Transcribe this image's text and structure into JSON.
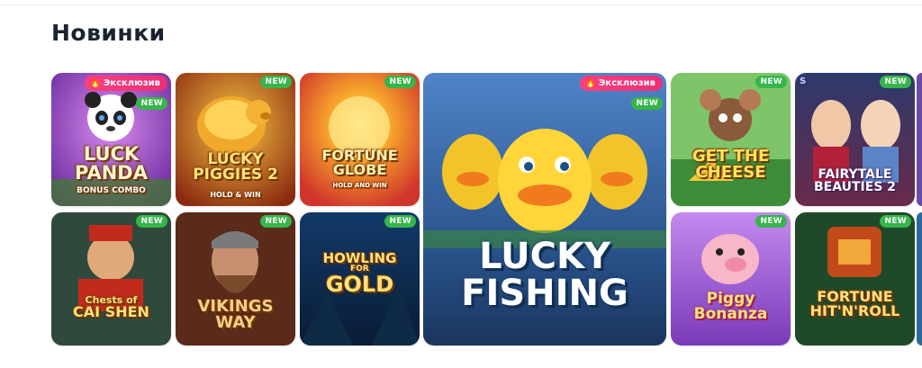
{
  "section": {
    "title": "Новинки"
  },
  "badges": {
    "new": "NEW",
    "exclusive": "Эксклюзив"
  },
  "games": [
    {
      "id": "luck-of-panda",
      "title_lines": [
        "LUCK",
        "PANDA"
      ],
      "subtitle": "BONUS COMBO",
      "badges": [
        "exclusive",
        "new"
      ]
    },
    {
      "id": "lucky-piggies-2",
      "title_lines": [
        "LUCKY",
        "PIGGIES 2"
      ],
      "subtitle": "HOLD & WIN",
      "badges": [
        "new"
      ]
    },
    {
      "id": "fortune-globe",
      "title_lines": [
        "FORTUNE",
        "GLOBE"
      ],
      "subtitle": "HOLD AND WIN",
      "badges": [
        "new"
      ]
    },
    {
      "id": "lucky-fishing",
      "title_lines": [
        "LUCKY",
        "FISHING"
      ],
      "subtitle": "",
      "badges": [
        "exclusive",
        "new"
      ]
    },
    {
      "id": "get-the-cheese",
      "title_lines": [
        "GET THE",
        "CHEESE"
      ],
      "subtitle": "",
      "badges": [
        "new"
      ]
    },
    {
      "id": "fairytale-beauties-2",
      "title_lines": [
        "FAIRYTALE",
        "BEAUTIES 2"
      ],
      "subtitle": "",
      "badges": [
        "new"
      ],
      "corner_mark": "S"
    },
    {
      "id": "chests-of-cai-shen",
      "title_lines": [
        "Chests of",
        "CAI SHEN"
      ],
      "subtitle": "",
      "badges": [
        "new"
      ]
    },
    {
      "id": "vikings-way",
      "title_lines": [
        "VIKINGS",
        "WAY"
      ],
      "subtitle": "",
      "badges": [
        "new"
      ]
    },
    {
      "id": "howling-for-gold",
      "title_lines": [
        "HOWLING",
        "GOLD"
      ],
      "subtitle": "FOR",
      "badges": [
        "new"
      ]
    },
    {
      "id": "piggy-bonanza",
      "title_lines": [
        "Piggy",
        "Bonanza"
      ],
      "subtitle": "",
      "badges": [
        "new"
      ]
    },
    {
      "id": "fortune-hit-n-roll",
      "title_lines": [
        "FORTUNE",
        "HIT'N'ROLL"
      ],
      "subtitle": "",
      "badges": [
        "new"
      ]
    }
  ],
  "colors": {
    "new_badge": "#35b54a",
    "exclusive_badge": "#ff3f7e",
    "title_text": "#1a2330"
  }
}
